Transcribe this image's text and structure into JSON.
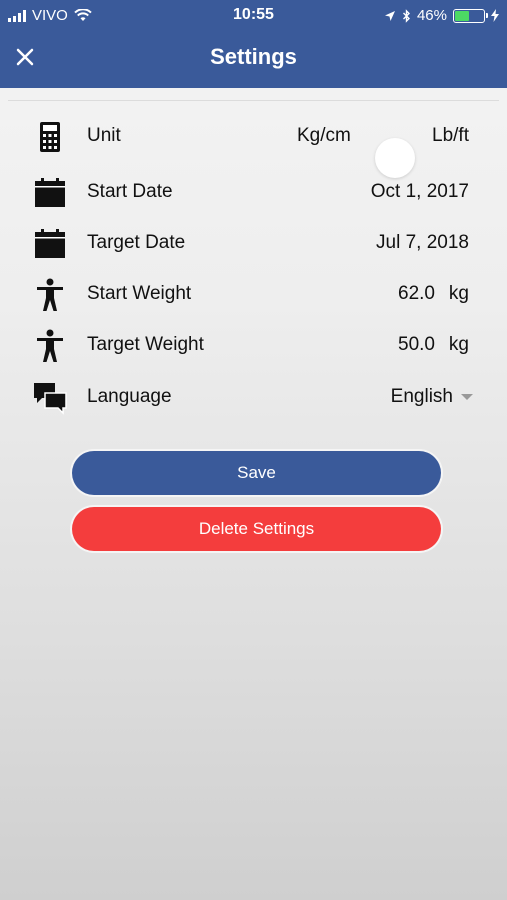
{
  "status_bar": {
    "carrier": "VIVO",
    "time": "10:55",
    "battery_percent": "46%",
    "battery_level": 0.46
  },
  "header": {
    "title": "Settings",
    "close_icon": "close-icon",
    "background": "#3a5a9a"
  },
  "settings": {
    "unit": {
      "label": "Unit",
      "option_metric": "Kg/cm",
      "option_imperial": "Lb/ft",
      "icon": "calculator-icon"
    },
    "start_date": {
      "label": "Start Date",
      "value": "Oct 1, 2017",
      "icon": "calendar-icon"
    },
    "target_date": {
      "label": "Target Date",
      "value": "Jul 7, 2018",
      "icon": "calendar-icon"
    },
    "start_weight": {
      "label": "Start Weight",
      "value": "62.0",
      "unit": "kg",
      "icon": "person-icon"
    },
    "target_weight": {
      "label": "Target Weight",
      "value": "50.0",
      "unit": "kg",
      "icon": "person-icon"
    },
    "language": {
      "label": "Language",
      "value": "English",
      "icon": "chat-bubbles-icon"
    }
  },
  "buttons": {
    "save": "Save",
    "delete": "Delete Settings",
    "save_color": "#3a5a9a",
    "delete_color": "#f43d3d"
  }
}
